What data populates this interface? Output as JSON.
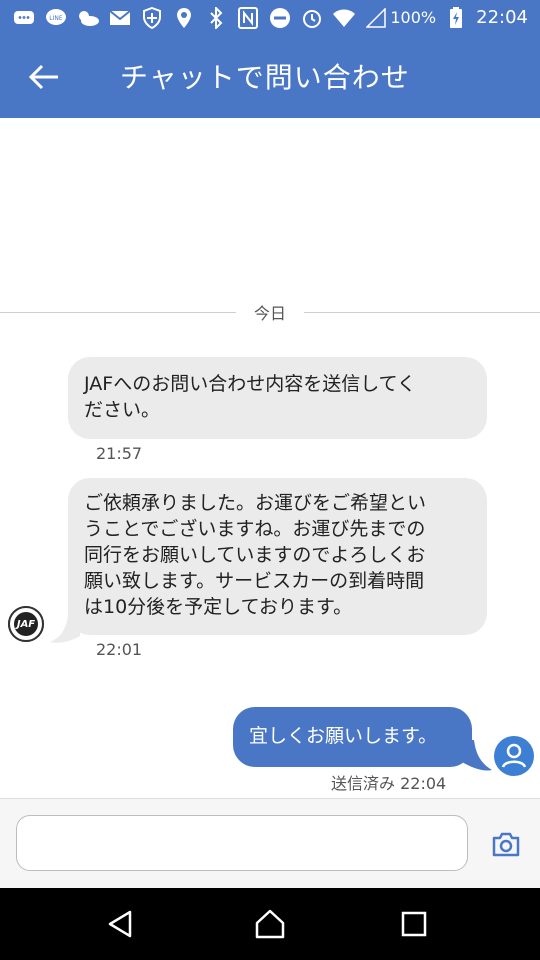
{
  "status_bar": {
    "icons": [
      "chat-bubble-icon",
      "line-icon",
      "weather-icon",
      "mail-icon",
      "shield-icon",
      "location-icon",
      "bluetooth-icon",
      "nfc-icon",
      "do-not-disturb-icon",
      "alarm-icon",
      "wifi-icon",
      "signal-icon"
    ],
    "battery": "100%",
    "time": "22:04"
  },
  "app_bar": {
    "title": "チャットで問い合わせ"
  },
  "chat": {
    "date_label": "今日",
    "messages": [
      {
        "direction": "in",
        "text_lines": [
          "JAFへのお問い合わせ内容を送信してく",
          "ださい。"
        ],
        "time": "21:57"
      },
      {
        "direction": "in",
        "text_lines": [
          "ご依頼承りました。お運びをご希望とい",
          "うことでございますね。お運び先までの",
          "同行をお願いしていますのでよろしくお",
          "願い致します。サービスカーの到着時間",
          "は10分後を予定しております。"
        ],
        "time": "22:01"
      },
      {
        "direction": "out",
        "text": "宜しくお願いします。",
        "status": "送信済み 22:04"
      }
    ]
  },
  "bot_avatar": {
    "logo_text": "JAF"
  },
  "input": {
    "value": "",
    "placeholder": ""
  },
  "colors": {
    "primary": "#4a76c6",
    "incoming_bubble": "#ebebeb",
    "outgoing_bubble": "#4a76c6"
  }
}
